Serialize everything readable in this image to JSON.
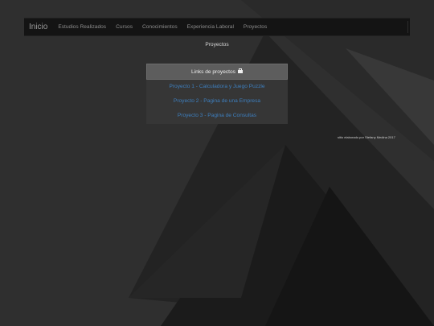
{
  "nav": {
    "brand": "Inicio",
    "items": [
      "Estudios Realizados",
      "Cursos",
      "Conocimientos",
      "Experiencia Laboral",
      "Proyectos"
    ]
  },
  "page": {
    "title": "Proyectos"
  },
  "panel": {
    "heading": "Links de proyectos",
    "heading_icon": "briefcase-icon",
    "links": [
      "Proyecto 1 - Calculadora y Juego Puzzle",
      "Proyecto 2 - Pagina de una Empresa",
      "Proyecto 3 - Pagina de Consultas"
    ]
  },
  "footer": {
    "note": "sitio elaborado por Stefany Medina 2017"
  },
  "colors": {
    "link": "#3d7fbf",
    "navbar": "#141414",
    "panel_heading": "#5d5d5d",
    "background": "#2f2f2f"
  }
}
